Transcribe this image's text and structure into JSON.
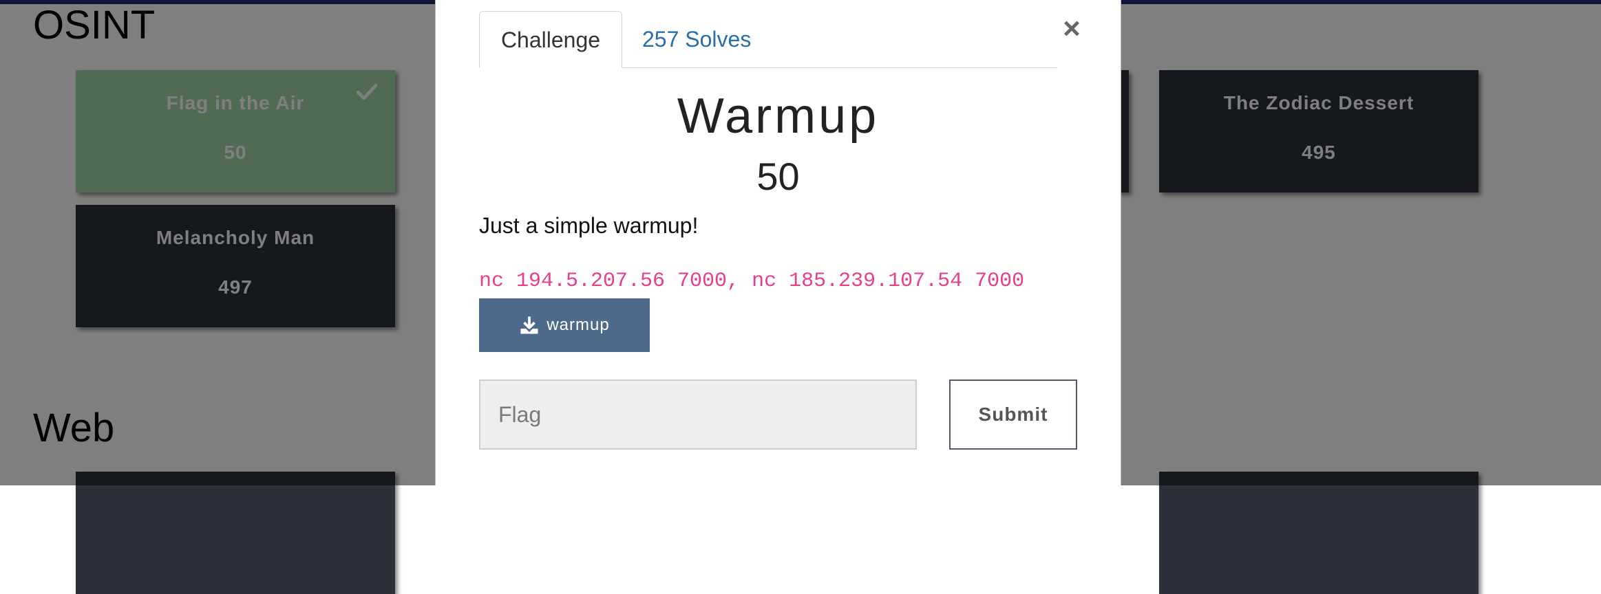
{
  "background": {
    "sections": [
      {
        "title": "OSINT"
      },
      {
        "title": "Web"
      }
    ],
    "cards": [
      {
        "name": "Flag in the Air",
        "points": "50",
        "solved": true
      },
      {
        "name": "Melancholy Man",
        "points": "497",
        "solved": false
      },
      {
        "name": "The Zodiac Dessert",
        "points": "495",
        "solved": false
      }
    ]
  },
  "modal": {
    "tabs": [
      {
        "label": "Challenge",
        "active": true
      },
      {
        "label": "257 Solves",
        "active": false
      }
    ],
    "close_label": "×",
    "title": "Warmup",
    "points": "50",
    "description": "Just a simple warmup!",
    "connection": "nc 194.5.207.56 7000, nc 185.239.107.54 7000",
    "download_label": "warmup",
    "flag_placeholder": "Flag",
    "submit_label": "Submit"
  },
  "colors": {
    "accent": "#4e6a8b",
    "solved_card": "#a2d7a5",
    "card": "#2b303b",
    "code": "#e83e8c",
    "link": "#2a6ea8"
  }
}
